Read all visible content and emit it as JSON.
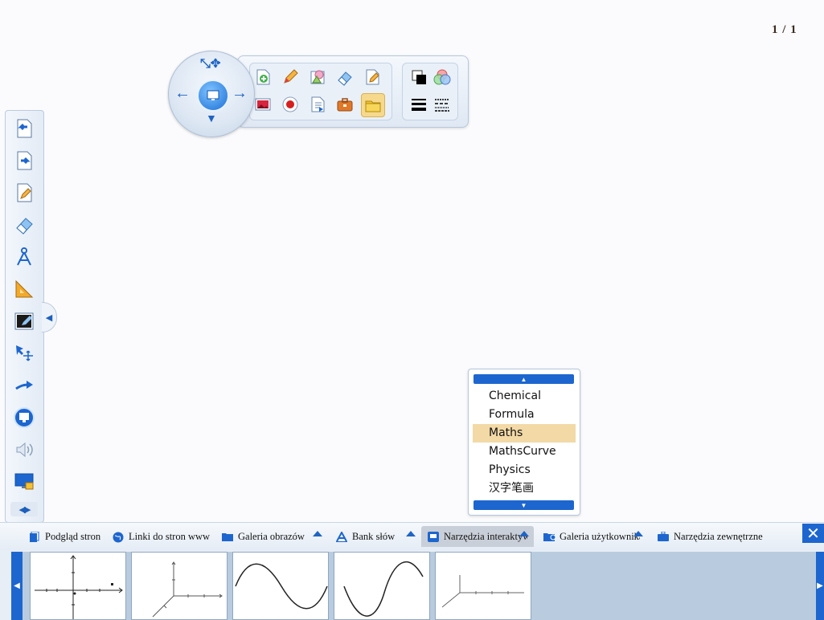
{
  "page_counter": "1 / 1",
  "floating_toolbar": {
    "row1": [
      "new-page-icon",
      "pen-icon",
      "shape-icon",
      "eraser-icon",
      "edit-pen-icon",
      "background-color-icon",
      "color-palette-icon"
    ],
    "row2": [
      "image-icon",
      "record-icon",
      "page-export-icon",
      "toolbox-icon",
      "folder-icon",
      "line-width-icon",
      "line-style-icon"
    ],
    "active_tool": "folder-icon"
  },
  "left_toolbar": {
    "buttons": [
      "previous-page-icon",
      "next-page-icon",
      "page-edit-icon",
      "eraser-icon",
      "compass-icon",
      "ruler-triangle-icon",
      "blackboard-icon",
      "select-move-icon",
      "arrow-icon",
      "screen-mode-icon",
      "speaker-icon",
      "lock-screen-icon"
    ]
  },
  "dropdown": {
    "items": [
      "Chemical",
      "Formula",
      "Maths",
      "MathsCurve",
      "Physics",
      "汉字笔画"
    ],
    "selected": "Maths"
  },
  "bottom_panel": {
    "tabs": [
      {
        "label": "Podgląd stron",
        "icon": "page-preview-icon"
      },
      {
        "label": "Linki do stron www",
        "icon": "globe-icon"
      },
      {
        "label": "Galeria obrazów",
        "icon": "folder-icon"
      },
      {
        "label": "Bank słów",
        "icon": "text-icon"
      },
      {
        "label": "Narzędzia interaktywne",
        "icon": "interactive-tools-icon"
      },
      {
        "label": "Galeria użytkownika",
        "icon": "user-gallery-icon"
      },
      {
        "label": "Narzędzia zewnętrzne",
        "icon": "toolbox-icon"
      }
    ],
    "selected_tab": "Narzędzia interaktywne",
    "thumbnails": [
      "2d-coordinate-plane",
      "3d-axes",
      "sine-curve",
      "cosine-curve",
      "3d-axes-plane"
    ]
  },
  "colors": {
    "accent_blue": "#1d66cf",
    "selected_item": "#f2d9a6",
    "panel_bg": "#e8eef6",
    "tab_selected": "#c9cfd8"
  }
}
